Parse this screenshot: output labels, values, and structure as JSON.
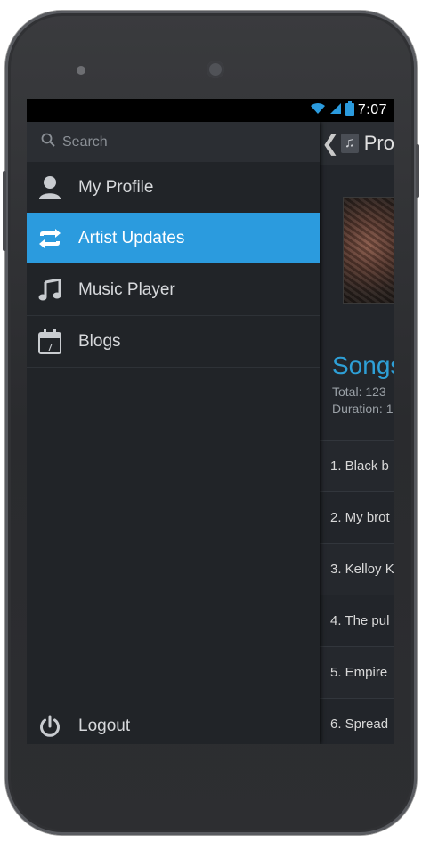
{
  "status_bar": {
    "time": "7:07",
    "icons": [
      "wifi-icon",
      "signal-icon",
      "battery-icon"
    ],
    "accent": "#2b9bde"
  },
  "drawer": {
    "search": {
      "placeholder": "Search",
      "icon": "search-icon"
    },
    "items": [
      {
        "label": "My Profile",
        "icon": "user-icon",
        "active": false
      },
      {
        "label": "Artist Updates",
        "icon": "repeat-icon",
        "active": true
      },
      {
        "label": "Music Player",
        "icon": "music-note-icon",
        "active": false
      },
      {
        "label": "Blogs",
        "icon": "calendar-icon",
        "active": false
      }
    ],
    "footer": {
      "label": "Logout",
      "icon": "power-icon"
    },
    "active_color": "#2b9bde"
  },
  "background_screen": {
    "title": "Pro",
    "songs_title": "Songs",
    "total": "Total: 123",
    "duration": "Duration: 1",
    "songs": [
      "1. Black b",
      "2. My brot",
      "3. Kelloy K",
      "4. The pul",
      "5. Empire",
      "6. Spread"
    ],
    "accent": "#2e9fd6"
  }
}
